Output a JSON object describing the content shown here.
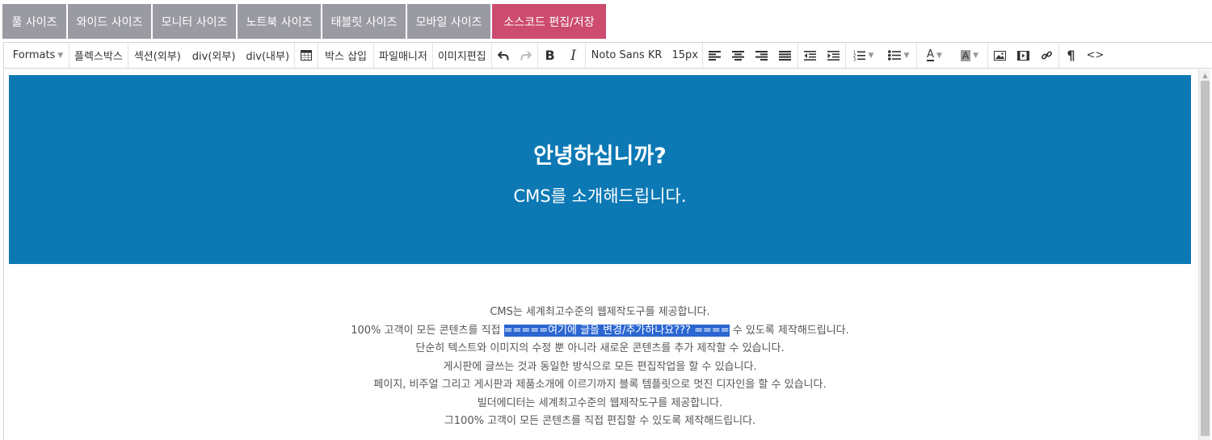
{
  "size_tabs": [
    {
      "label": "풀 사이즈"
    },
    {
      "label": "와이드 사이즈"
    },
    {
      "label": "모니터 사이즈"
    },
    {
      "label": "노트북 사이즈"
    },
    {
      "label": "태블릿 사이즈"
    },
    {
      "label": "모바일 사이즈"
    },
    {
      "label": "소스코드 편집/저장",
      "active": true,
      "color": "#cc4b6e"
    }
  ],
  "toolbar": {
    "formats": "Formats",
    "flexbox": "플렉스박스",
    "section_outer": "섹션(외부)",
    "div_outer": "div(외부)",
    "div_inner": "div(내부)",
    "table_icon": "table-icon",
    "box_insert": "박스 삽입",
    "file_manager": "파일매니저",
    "image_edit": "이미지편집",
    "undo_icon": "undo-icon",
    "redo_icon": "redo-icon",
    "bold": "B",
    "italic": "I",
    "font_family": "Noto Sans KR",
    "font_size": "15px",
    "text_color_label": "A",
    "bg_color_label": "A",
    "paragraph_mark": "¶",
    "code_view": "<>"
  },
  "banner": {
    "title": "안녕하십니까?",
    "subtitle": "CMS를 소개해드립니다.",
    "bg_color": "#0c79b5"
  },
  "content": {
    "line1": "CMS는 세계최고수준의 웹제작도구를 제공합니다.",
    "line2_before": "100% 고객이 모든 콘텐츠를 직접 ",
    "line2_selected": "=====여기에 글을 변경/추가하나요??? ====",
    "line2_after": " 수 있도록 제작해드립니다.",
    "line3": "단순히 텍스트와 이미지의 수정 뿐 아니라 새로운 콘텐츠를 추가 제작할 수 있습니다.",
    "line4": "게시판에 글쓰는 것과 동일한 방식으로 모든 편집작업을 할 수 있습니다.",
    "line5": "페이지, 비주얼 그리고 게시판과 제품소개에 이르기까지 블록 템플릿으로 멋진 디자인을 할 수 있습니다.",
    "line6": "빌더에디터는 세계최고수준의 웹제작도구를 제공합니다.",
    "line7": "그100% 고객이 모든 콘텐츠를 직접 편집할 수 있도록 제작해드립니다."
  }
}
